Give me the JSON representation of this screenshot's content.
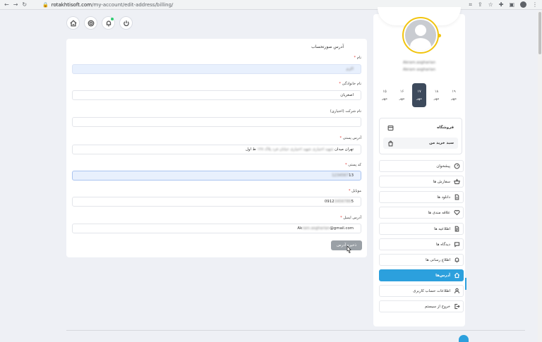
{
  "browser": {
    "url_domain": "rotakhtisoft.com",
    "url_path": "/my-account/edit-address/billing/"
  },
  "form": {
    "title": "آدرس صورتحساب",
    "fields": [
      {
        "label": "نام",
        "required": true,
        "value": "اکرم"
      },
      {
        "label": "نام خانوادگی",
        "required": true,
        "value": "اصغریان"
      },
      {
        "label": "نام شرکت (اختیاری)",
        "required": false,
        "value": ""
      },
      {
        "label": "آدرس پستی",
        "required": true,
        "value_visible": "تهران میدان",
        "value_hidden": "شهید اختیاری شهید اختیاری خیابان فرد پلاک ۱۲۸",
        "value_tail": "ط اول"
      },
      {
        "label": "کد پستی",
        "required": true,
        "value_hidden": "1234567",
        "value_tail": "13"
      },
      {
        "label": "موبایل",
        "required": true,
        "value_visible": "0912",
        "value_hidden": "3456789",
        "value_tail": "5"
      },
      {
        "label": "آدرس ایمیل",
        "required": true,
        "value_visible": "Ak",
        "value_hidden": "ram.asgharian",
        "value_tail": "@gmail.com"
      }
    ],
    "save_label": "ذخیره آدرس"
  },
  "profile": {
    "name_line1": "Akram.asgharian",
    "name_line2": "Akram asgharian"
  },
  "dates": [
    {
      "day": "۱۹",
      "month": "مهر",
      "active": false
    },
    {
      "day": "۱۸",
      "month": "مهر",
      "active": false
    },
    {
      "day": "۱۷",
      "month": "مهر",
      "active": true
    },
    {
      "day": "۱۶",
      "month": "مهر",
      "active": false
    },
    {
      "day": "۱۵",
      "month": "مهر",
      "active": false
    }
  ],
  "shop": {
    "store_label": "فروشگاه",
    "cart_label": "سبد خرید من"
  },
  "menu": [
    {
      "label": "پیشخوان",
      "icon": "gauge-icon",
      "active": false
    },
    {
      "label": "سفارش ها",
      "icon": "basket-icon",
      "active": false
    },
    {
      "label": "دانلود ها",
      "icon": "file-icon",
      "active": false
    },
    {
      "label": "علاقه مندی ها",
      "icon": "heart-icon",
      "active": false
    },
    {
      "label": "اطلاعیه ها",
      "icon": "document-icon",
      "active": false
    },
    {
      "label": "دیدگاه ها",
      "icon": "chat-icon",
      "active": false
    },
    {
      "label": "اطلاع رسانی ها",
      "icon": "bell-icon",
      "active": false
    },
    {
      "label": "آدرس‌ها",
      "icon": "home-icon",
      "active": true
    },
    {
      "label": "اطلاعات حساب کاربری",
      "icon": "user-icon",
      "active": false
    },
    {
      "label": "خروج از سیستم",
      "icon": "logout-icon",
      "active": false
    }
  ]
}
